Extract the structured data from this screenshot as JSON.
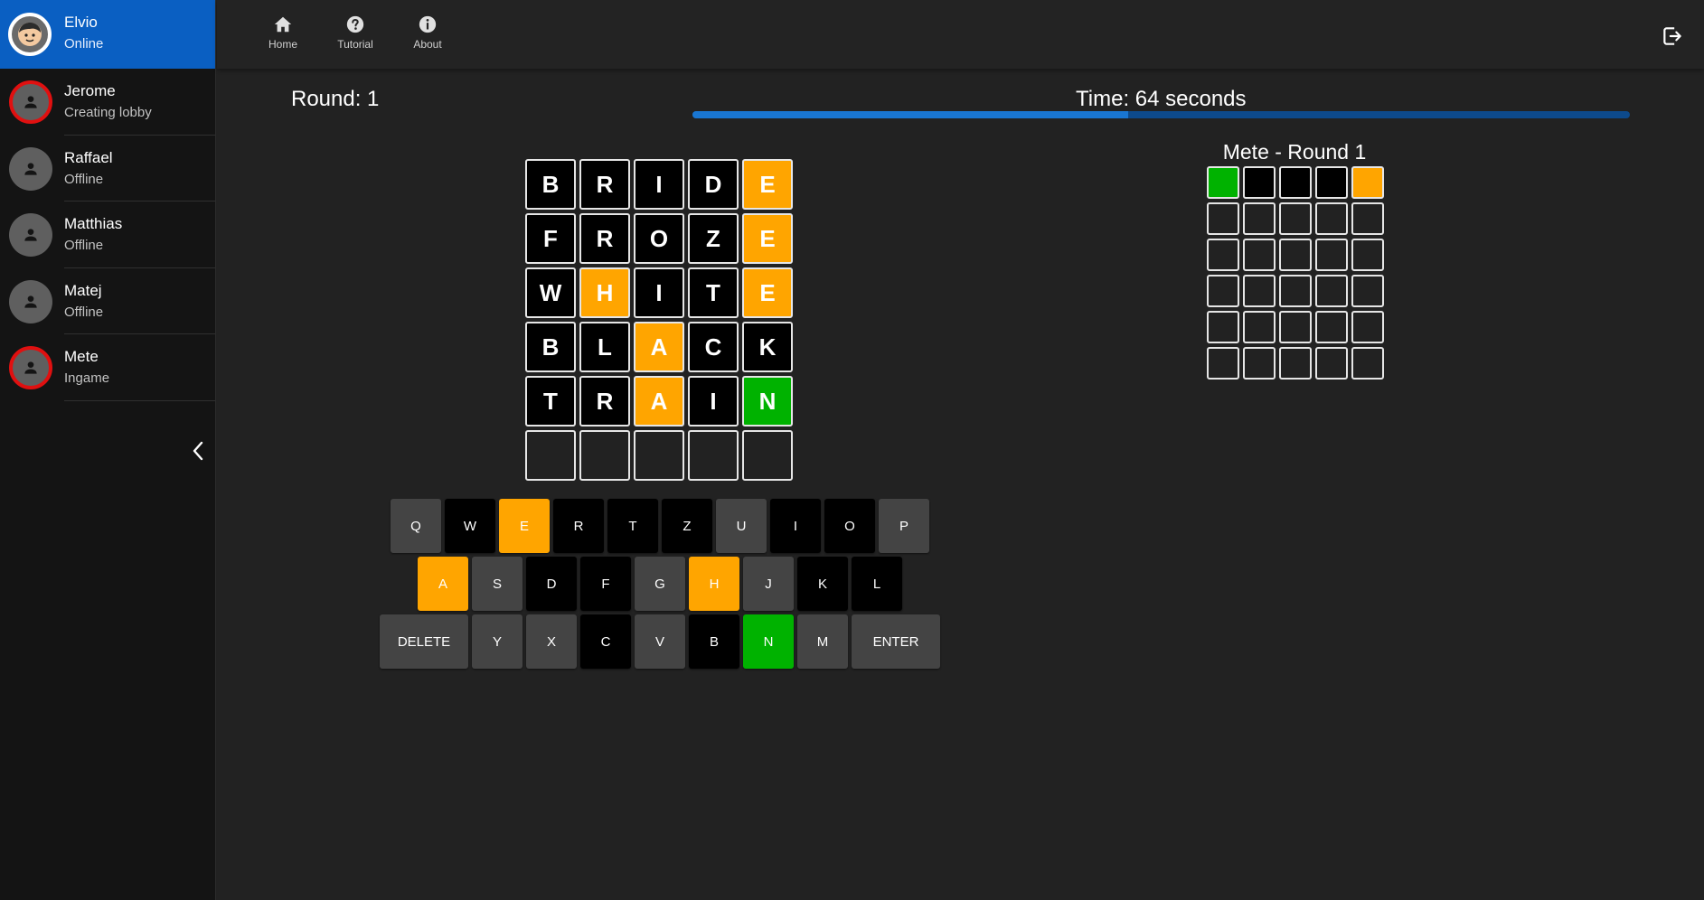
{
  "sidebar": {
    "users": [
      {
        "name": "Elvio",
        "status": "Online",
        "me": true,
        "ring": false,
        "icon": "smiley-avatar-icon"
      },
      {
        "name": "Jerome",
        "status": "Creating lobby",
        "me": false,
        "ring": true,
        "icon": "person-icon"
      },
      {
        "name": "Raffael",
        "status": "Offline",
        "me": false,
        "ring": false,
        "icon": "person-icon"
      },
      {
        "name": "Matthias",
        "status": "Offline",
        "me": false,
        "ring": false,
        "icon": "person-icon"
      },
      {
        "name": "Matej",
        "status": "Offline",
        "me": false,
        "ring": false,
        "icon": "person-icon"
      },
      {
        "name": "Mete",
        "status": "Ingame",
        "me": false,
        "ring": true,
        "icon": "person-icon"
      }
    ],
    "collapse_icon": "chevron-left-icon"
  },
  "nav": {
    "items": [
      {
        "label": "Home",
        "icon": "home-icon"
      },
      {
        "label": "Tutorial",
        "icon": "help-icon"
      },
      {
        "label": "About",
        "icon": "info-icon"
      }
    ],
    "logout_icon": "logout-icon"
  },
  "game": {
    "round_label": "Round: 1",
    "time_label": "Time: 64 seconds",
    "time_progress": 0.465,
    "board": [
      [
        {
          "l": "B",
          "s": "absent"
        },
        {
          "l": "R",
          "s": "absent"
        },
        {
          "l": "I",
          "s": "absent"
        },
        {
          "l": "D",
          "s": "absent"
        },
        {
          "l": "E",
          "s": "present"
        }
      ],
      [
        {
          "l": "F",
          "s": "absent"
        },
        {
          "l": "R",
          "s": "absent"
        },
        {
          "l": "O",
          "s": "absent"
        },
        {
          "l": "Z",
          "s": "absent"
        },
        {
          "l": "E",
          "s": "present"
        }
      ],
      [
        {
          "l": "W",
          "s": "absent"
        },
        {
          "l": "H",
          "s": "present"
        },
        {
          "l": "I",
          "s": "absent"
        },
        {
          "l": "T",
          "s": "absent"
        },
        {
          "l": "E",
          "s": "present"
        }
      ],
      [
        {
          "l": "B",
          "s": "absent"
        },
        {
          "l": "L",
          "s": "absent"
        },
        {
          "l": "A",
          "s": "present"
        },
        {
          "l": "C",
          "s": "absent"
        },
        {
          "l": "K",
          "s": "absent"
        }
      ],
      [
        {
          "l": "T",
          "s": "absent"
        },
        {
          "l": "R",
          "s": "absent"
        },
        {
          "l": "A",
          "s": "present"
        },
        {
          "l": "I",
          "s": "absent"
        },
        {
          "l": "N",
          "s": "correct"
        }
      ],
      [
        {
          "l": "",
          "s": "empty"
        },
        {
          "l": "",
          "s": "empty"
        },
        {
          "l": "",
          "s": "empty"
        },
        {
          "l": "",
          "s": "empty"
        },
        {
          "l": "",
          "s": "empty"
        }
      ]
    ]
  },
  "keyboard": {
    "rows": [
      [
        {
          "k": "Q",
          "s": "unused"
        },
        {
          "k": "W",
          "s": "absent"
        },
        {
          "k": "E",
          "s": "present"
        },
        {
          "k": "R",
          "s": "absent"
        },
        {
          "k": "T",
          "s": "absent"
        },
        {
          "k": "Z",
          "s": "absent"
        },
        {
          "k": "U",
          "s": "unused"
        },
        {
          "k": "I",
          "s": "absent"
        },
        {
          "k": "O",
          "s": "absent"
        },
        {
          "k": "P",
          "s": "unused"
        }
      ],
      [
        {
          "k": "A",
          "s": "present"
        },
        {
          "k": "S",
          "s": "unused"
        },
        {
          "k": "D",
          "s": "absent"
        },
        {
          "k": "F",
          "s": "absent"
        },
        {
          "k": "G",
          "s": "unused"
        },
        {
          "k": "H",
          "s": "present"
        },
        {
          "k": "J",
          "s": "unused"
        },
        {
          "k": "K",
          "s": "absent"
        },
        {
          "k": "L",
          "s": "absent"
        }
      ],
      [
        {
          "k": "DELETE",
          "s": "unused",
          "wide": true
        },
        {
          "k": "Y",
          "s": "unused"
        },
        {
          "k": "X",
          "s": "unused"
        },
        {
          "k": "C",
          "s": "absent"
        },
        {
          "k": "V",
          "s": "unused"
        },
        {
          "k": "B",
          "s": "absent"
        },
        {
          "k": "N",
          "s": "correct"
        },
        {
          "k": "M",
          "s": "unused"
        },
        {
          "k": "ENTER",
          "s": "unused",
          "wide": true
        }
      ]
    ]
  },
  "opponent": {
    "title": "Mete - Round 1",
    "board": [
      [
        "correct",
        "absent",
        "absent",
        "absent",
        "present"
      ],
      [
        "empty",
        "empty",
        "empty",
        "empty",
        "empty"
      ],
      [
        "empty",
        "empty",
        "empty",
        "empty",
        "empty"
      ],
      [
        "empty",
        "empty",
        "empty",
        "empty",
        "empty"
      ],
      [
        "empty",
        "empty",
        "empty",
        "empty",
        "empty"
      ],
      [
        "empty",
        "empty",
        "empty",
        "empty",
        "empty"
      ]
    ]
  },
  "colors": {
    "accent": "#0a5fc2",
    "present": "#ffa500",
    "correct": "#00b200",
    "absent": "#000000",
    "unused_key": "#444444",
    "ring": "#e01010"
  }
}
